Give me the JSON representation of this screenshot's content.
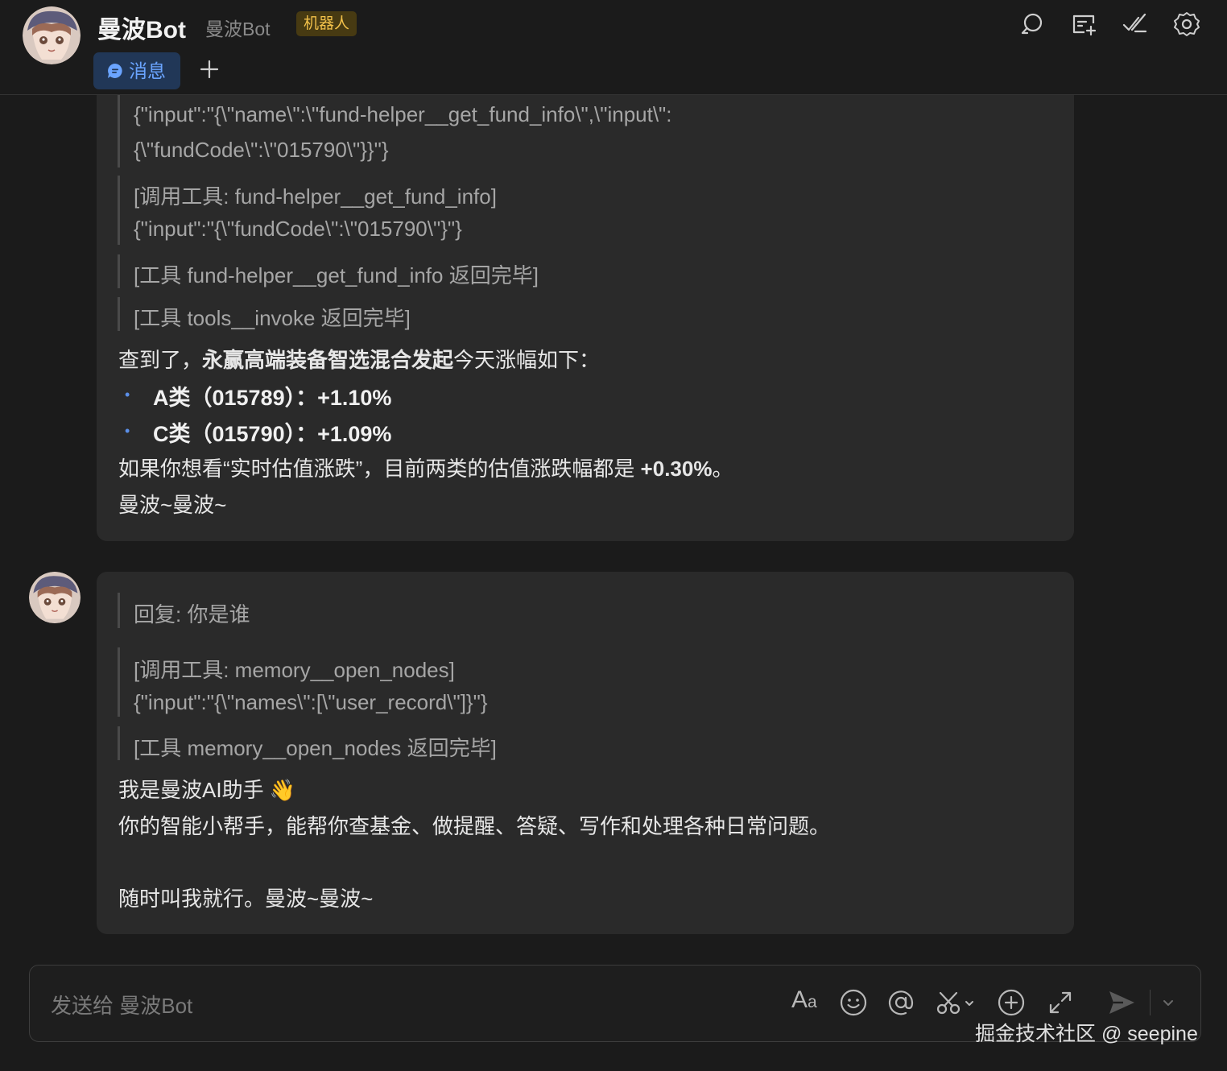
{
  "header": {
    "title": "曼波Bot",
    "subtitle": "曼波Bot",
    "badge": "机器人",
    "tab_label": "消息",
    "icons": [
      "search-icon",
      "new-chat-icon",
      "edit-check-icon",
      "gear-icon"
    ]
  },
  "messages": {
    "first": {
      "quote1_line1": "{\"input\":\"{\\\"name\\\":\\\"fund-helper__get_fund_info\\\",\\\"input\\\":",
      "quote1_line2": "{\\\"fundCode\\\":\\\"015790\\\"}}\"}",
      "quote2_line1": "[调用工具: fund-helper__get_fund_info]",
      "quote2_line2": "{\"input\":\"{\\\"fundCode\\\":\\\"015790\\\"}\"}",
      "quote3": "[工具 fund-helper__get_fund_info 返回完毕]",
      "quote4": "[工具 tools__invoke 返回完毕]",
      "intro_prefix": "查到了，",
      "intro_bold": "永赢高端装备智选混合发起",
      "intro_suffix": "今天涨幅如下：",
      "bullets": [
        "A类（015789）：+1.10%",
        "C类（015790）：+1.09%"
      ],
      "estimate_prefix": "如果你想看“实时估值涨跌”，目前两类的估值涨跌幅都是 ",
      "estimate_bold": "+0.30%",
      "estimate_suffix": "。",
      "signoff": "曼波~曼波~"
    },
    "second": {
      "quote1": "回复: 你是谁",
      "quote2_line1": "[调用工具: memory__open_nodes]",
      "quote2_line2": "{\"input\":\"{\\\"names\\\":[\\\"user_record\\\"]}\"}",
      "quote3": "[工具 memory__open_nodes 返回完毕]",
      "line1": "我是曼波AI助手 👋",
      "line2": "你的智能小帮手，能帮你查基金、做提醒、答疑、写作和处理各种日常问题。",
      "line3": "随时叫我就行。曼波~曼波~"
    }
  },
  "composer": {
    "placeholder": "发送给 曼波Bot",
    "format_label": "Aa",
    "icons": [
      "format-text-icon",
      "emoji-icon",
      "mention-icon",
      "screenshot-scissors-icon",
      "add-circle-icon",
      "expand-icon",
      "send-icon",
      "chevron-down-icon"
    ]
  },
  "watermark": "掘金技术社区 @ seepine",
  "colors": {
    "background": "#1b1b1b",
    "bubble": "#2a2a2a",
    "accent": "#6aa4ff",
    "badge_text": "#f1c04a",
    "badge_bg": "#473a12"
  }
}
